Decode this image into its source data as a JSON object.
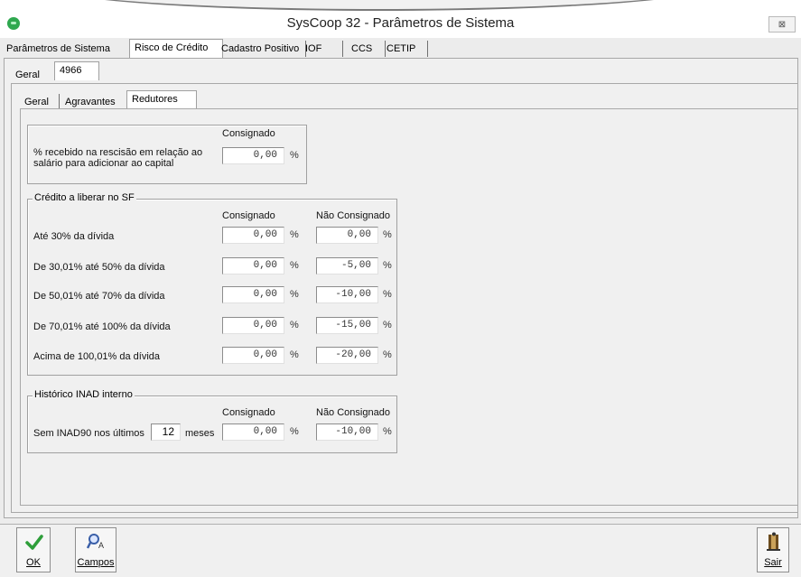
{
  "window": {
    "title": "SysCoop 32 - Parâmetros de Sistema",
    "close_glyph": "⊠"
  },
  "main_tabs": [
    {
      "label": "Parâmetros de Sistema"
    },
    {
      "label": "Risco de Crédito"
    },
    {
      "label": "Cadastro Positivo"
    },
    {
      "label": "IOF"
    },
    {
      "label": "CCS"
    },
    {
      "label": "CETIP"
    }
  ],
  "sub_tabs": [
    {
      "label": "Geral"
    },
    {
      "label": "4966"
    }
  ],
  "inner_tabs": [
    {
      "label": "Geral"
    },
    {
      "label": "Agravantes"
    },
    {
      "label": "Redutores"
    }
  ],
  "rescisao": {
    "column_header": "Consignado",
    "label_line1": "% recebido na rescisão em relação ao",
    "label_line2": "salário para adicionar ao capital",
    "value": "0,00",
    "unit": "%"
  },
  "credito": {
    "title": "Crédito a liberar no SF",
    "col_consignado": "Consignado",
    "col_nao_consignado": "Não Consignado",
    "unit": "%",
    "rows": [
      {
        "label": "Até 30% da dívida",
        "consignado": "0,00",
        "nao_consignado": "0,00"
      },
      {
        "label": "De 30,01% até 50% da dívida",
        "consignado": "0,00",
        "nao_consignado": "-5,00"
      },
      {
        "label": "De 50,01% até 70% da dívida",
        "consignado": "0,00",
        "nao_consignado": "-10,00"
      },
      {
        "label": "De 70,01% até 100% da dívida",
        "consignado": "0,00",
        "nao_consignado": "-15,00"
      },
      {
        "label": "Acima de 100,01% da dívida",
        "consignado": "0,00",
        "nao_consignado": "-20,00"
      }
    ]
  },
  "historico": {
    "title": "Histórico INAD interno",
    "col_consignado": "Consignado",
    "col_nao_consignado": "Não Consignado",
    "label_prefix": "Sem INAD90 nos últimos",
    "months_value": "12",
    "label_suffix": "meses",
    "consignado": "0,00",
    "nao_consignado": "-10,00",
    "unit": "%"
  },
  "toolbar": {
    "ok_label": "OK",
    "campos_label": "Campos",
    "sair_label": "Sair"
  },
  "colors": {
    "ok_check": "#2e9e3a",
    "app_icon": "#2fa84f"
  }
}
